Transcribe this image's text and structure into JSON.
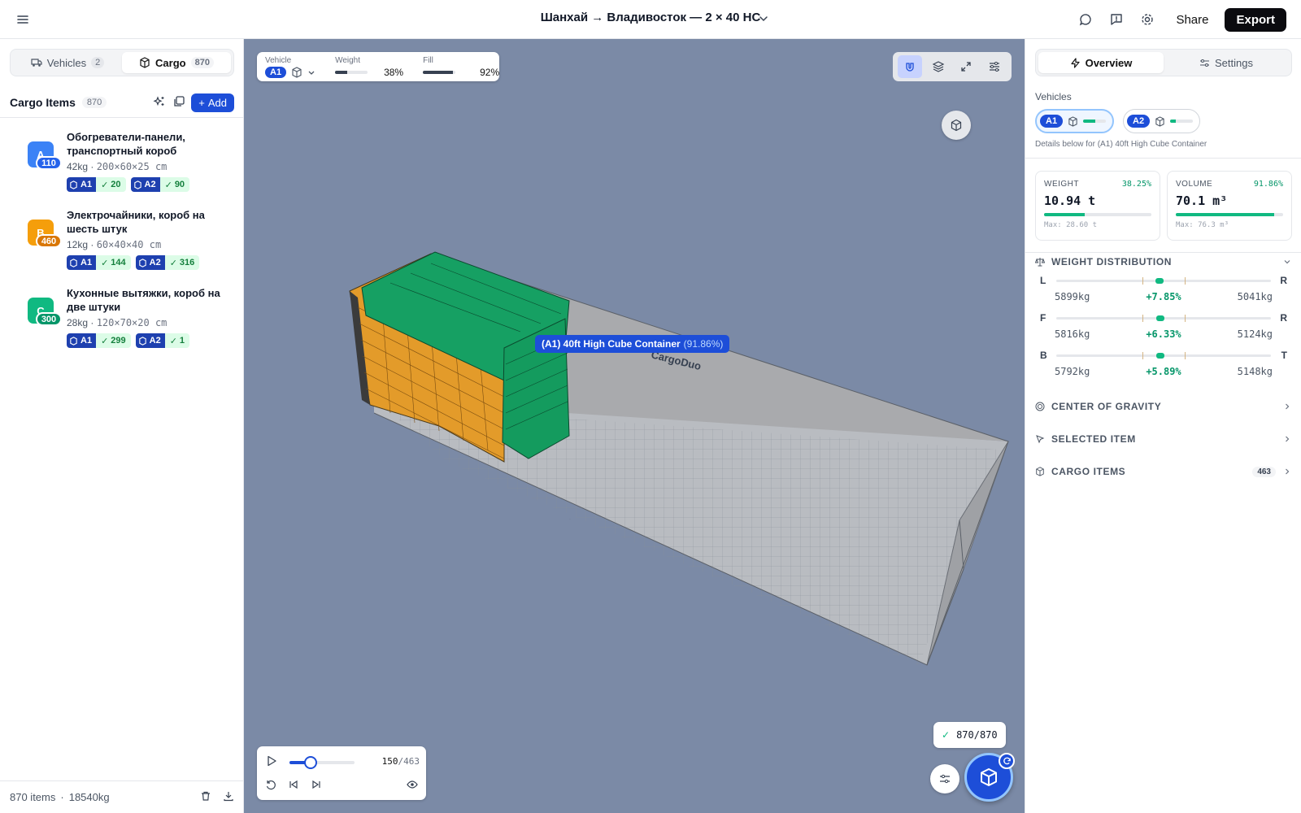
{
  "title": "Шанхай → Владивосток — 2 × 40 HC",
  "top_actions": {
    "share": "Share",
    "export": "Export"
  },
  "left": {
    "tabs": [
      {
        "label": "Vehicles",
        "count": "2"
      },
      {
        "label": "Cargo",
        "count": "870"
      }
    ],
    "list_title": "Cargo Items",
    "list_count": "870",
    "add_label": "Add",
    "items": [
      {
        "letter": "A",
        "badge": "110",
        "color": "#3b82f6",
        "name": "Обогреватели-панели, транспортный короб",
        "weight": "42kg",
        "dims": "200×60×25 cm",
        "a1_label": "A1",
        "a1_qty": "20",
        "a2_label": "A2",
        "a2_qty": "90"
      },
      {
        "letter": "B",
        "badge": "460",
        "color": "#f59e0b",
        "name": "Электрочайники, короб на шесть штук",
        "weight": "12kg",
        "dims": "60×40×40 cm",
        "a1_label": "A1",
        "a1_qty": "144",
        "a2_label": "A2",
        "a2_qty": "316"
      },
      {
        "letter": "C",
        "badge": "300",
        "color": "#10b981",
        "name": "Кухонные вытяжки, короб на две штуки",
        "weight": "28kg",
        "dims": "120×70×20 cm",
        "a1_label": "A1",
        "a1_qty": "299",
        "a2_label": "A2",
        "a2_qty": "1"
      }
    ],
    "footer": {
      "items": "870 items",
      "weight": "18540kg"
    }
  },
  "viewport": {
    "hud": {
      "vehicle_label": "Vehicle",
      "vehicle": "A1",
      "weight_label": "Weight",
      "weight": "38%",
      "weight_fraction": 0.38,
      "fill_label": "Fill",
      "fill": "92%",
      "fill_fraction": 0.92
    },
    "tooltip": {
      "name": "(A1) 40ft High Cube Container",
      "pct": "(91.86%)"
    },
    "brand_mark": "CargoDuo",
    "placed_count": "870/870",
    "player": {
      "step": "150",
      "total": "/463",
      "progress_fraction": 0.324
    }
  },
  "right": {
    "tabs": [
      "Overview",
      "Settings"
    ],
    "vehicles_label": "Vehicles",
    "vehicles": [
      {
        "label": "A1",
        "fill_fraction": 0.55
      },
      {
        "label": "A2",
        "fill_fraction": 0.25
      }
    ],
    "details_note": "Details below for (A1) 40ft High Cube Container",
    "weight": {
      "label": "WEIGHT",
      "pct": "38.25%",
      "value": "10.94 t",
      "max": "Max: 28.60 t",
      "fraction": 0.3825
    },
    "volume": {
      "label": "VOLUME",
      "pct": "91.86%",
      "value": "70.1 m³",
      "max": "Max: 76.3 m³",
      "fraction": 0.9186
    },
    "weight_distribution": {
      "title": "WEIGHT DISTRIBUTION",
      "rows": [
        {
          "left": "L",
          "right": "R",
          "left_val": "5899kg",
          "delta": "+7.85%",
          "right_val": "5041kg",
          "position": 0.48
        },
        {
          "left": "F",
          "right": "R",
          "left_val": "5816kg",
          "delta": "+6.33%",
          "right_val": "5124kg",
          "position": 0.485
        },
        {
          "left": "B",
          "right": "T",
          "left_val": "5792kg",
          "delta": "+5.89%",
          "right_val": "5148kg",
          "position": 0.485
        }
      ]
    },
    "sections": [
      {
        "label": "CENTER OF GRAVITY"
      },
      {
        "label": "SELECTED ITEM"
      },
      {
        "label": "CARGO ITEMS",
        "count": "463"
      }
    ]
  }
}
